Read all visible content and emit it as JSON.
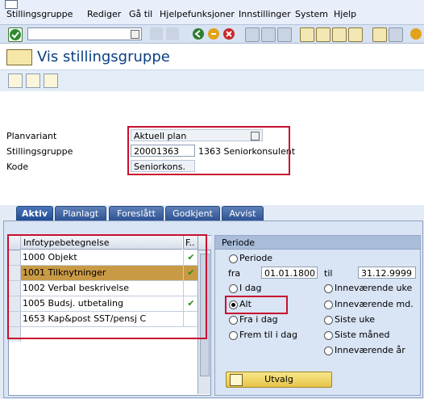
{
  "menu": {
    "items": [
      "Stillingsgruppe",
      "Rediger",
      "Gå til",
      "Hjelpefunksjoner",
      "Innstillinger",
      "System",
      "Hjelp"
    ]
  },
  "toolbar": {
    "command_value": ""
  },
  "page": {
    "title": "Vis stillingsgruppe"
  },
  "form": {
    "planvariant_label": "Planvariant",
    "planvariant_value": "Aktuell plan",
    "stillingsgruppe_label": "Stillingsgruppe",
    "stillingsgruppe_value": "20001363",
    "stillingsgruppe_desc": "1363 Seniorkonsulent",
    "kode_label": "Kode",
    "kode_value": "Seniorkons."
  },
  "tabs": [
    "Aktiv",
    "Planlagt",
    "Foreslått",
    "Godkjent",
    "Avvist"
  ],
  "table": {
    "col_infotype": "Infotypebetegnelse",
    "col_flag": "F..",
    "rows": [
      {
        "label": "1000 Objekt",
        "checked": true
      },
      {
        "label": "1001 Tilknytninger",
        "checked": true
      },
      {
        "label": "1002 Verbal beskrivelse",
        "checked": false
      },
      {
        "label": "1005 Budsj. utbetaling",
        "checked": true
      },
      {
        "label": "1653 Kap&post SST/pensj C",
        "checked": false
      }
    ]
  },
  "periode": {
    "header": "Periode",
    "opt_periode": "Periode",
    "fra_label": "fra",
    "fra_value": "01.01.1800",
    "til_label": "til",
    "til_value": "31.12.9999",
    "opt_idag": "I dag",
    "opt_alt": "Alt",
    "opt_fra_idag": "Fra i dag",
    "opt_frem_til_idag": "Frem til i dag",
    "opt_innev_uke": "Inneværende uke",
    "opt_innev_md": "Inneværende md.",
    "opt_siste_uke": "Siste uke",
    "opt_siste_mnd": "Siste måned",
    "opt_innev_ar": "Inneværende år",
    "utvalg_label": "Utvalg"
  },
  "colors": {
    "title": "#0b3f85",
    "highlight_row": "#c99a45",
    "annotation_red": "#c8102e",
    "check_green": "#2d8c1e"
  }
}
